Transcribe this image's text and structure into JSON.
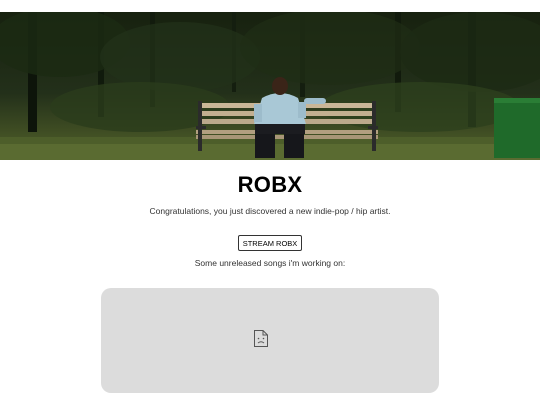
{
  "artist": {
    "name": "ROBX",
    "tagline": "Congratulations, you just discovered a new indie-pop / hip artist."
  },
  "hero": {
    "image_icon": "photo-of-artist-on-park-bench"
  },
  "actions": {
    "stream_label": "STREAM ROBX"
  },
  "songs_section": {
    "heading": "Some unreleased songs i'm working on:",
    "embed_icon": "broken-document-icon"
  },
  "colors": {
    "embed_background": "#dcdcdc",
    "text": "#333333",
    "title": "#000000"
  }
}
